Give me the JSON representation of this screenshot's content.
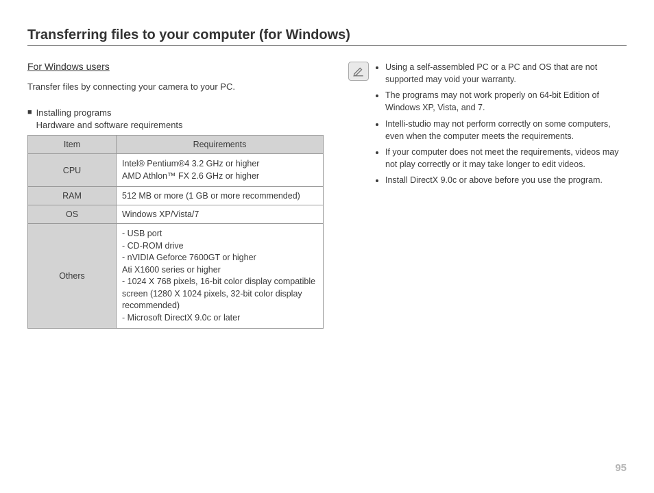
{
  "pageTitle": "Transferring files to your computer (for Windows)",
  "sectionHeading": "For Windows users",
  "intro": "Transfer files by connecting your camera to your PC.",
  "subhead": {
    "line1": "Installing programs",
    "line2": "Hardware and software requirements"
  },
  "table": {
    "headers": {
      "item": "Item",
      "req": "Requirements"
    },
    "rows": [
      {
        "label": "CPU",
        "value": "Intel® Pentium®4 3.2 GHz or higher\nAMD Athlon™ FX 2.6 GHz or higher"
      },
      {
        "label": "RAM",
        "value": "512 MB or more (1 GB or more recommended)"
      },
      {
        "label": "OS",
        "value": "Windows XP/Vista/7"
      },
      {
        "label": "Others",
        "value": "- USB port\n- CD-ROM drive\n- nVIDIA Geforce 7600GT or higher\n  Ati X1600 series or higher\n- 1024 X 768 pixels, 16-bit color display compatible\n  screen (1280 X 1024 pixels, 32-bit color display\n  recommended)\n- Microsoft DirectX 9.0c or later"
      }
    ]
  },
  "notes": [
    "Using a self-assembled PC or a PC and OS that are not supported may void your warranty.",
    "The programs may not work properly on 64-bit Edition of Windows XP, Vista, and 7.",
    "Intelli-studio may not perform correctly on some computers, even when the computer meets the requirements.",
    "If your computer does not meet the requirements, videos may not play correctly or it may take longer to edit videos.",
    "Install DirectX 9.0c or above before you use the program."
  ],
  "pageNumber": "95"
}
